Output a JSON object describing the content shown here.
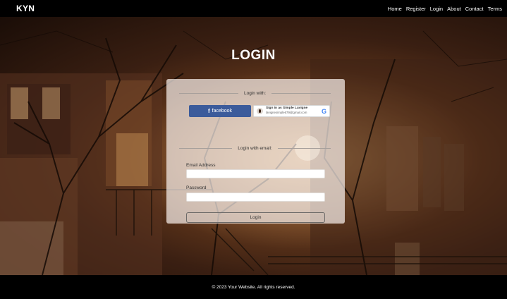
{
  "brand": "KYN",
  "nav": [
    {
      "label": "Home"
    },
    {
      "label": "Register"
    },
    {
      "label": "Login"
    },
    {
      "label": "About"
    },
    {
      "label": "Contact"
    },
    {
      "label": "Terms"
    }
  ],
  "page_title": "LOGIN",
  "login_card": {
    "social_divider": "Login with:",
    "facebook": {
      "icon_text": "f",
      "label": "facebook"
    },
    "google": {
      "name": "Sign in as Simple Lavigne",
      "email": "lavignesimple679@gmail.com",
      "icon_text": "G"
    },
    "email_divider": "Login with email:",
    "email_label": "Email Address",
    "email_value": "",
    "email_placeholder": "",
    "password_label": "Password",
    "password_value": "",
    "password_placeholder": "",
    "submit_label": "Login"
  },
  "footer": "© 2023 Your Website. All rights reserved.",
  "colors": {
    "navbar": "#000000",
    "facebook": "#3b5b9b",
    "card": "#f6eeea",
    "footer": "#000000"
  },
  "icons": [
    "facebook-icon",
    "google-icon",
    "user-avatar-icon"
  ]
}
